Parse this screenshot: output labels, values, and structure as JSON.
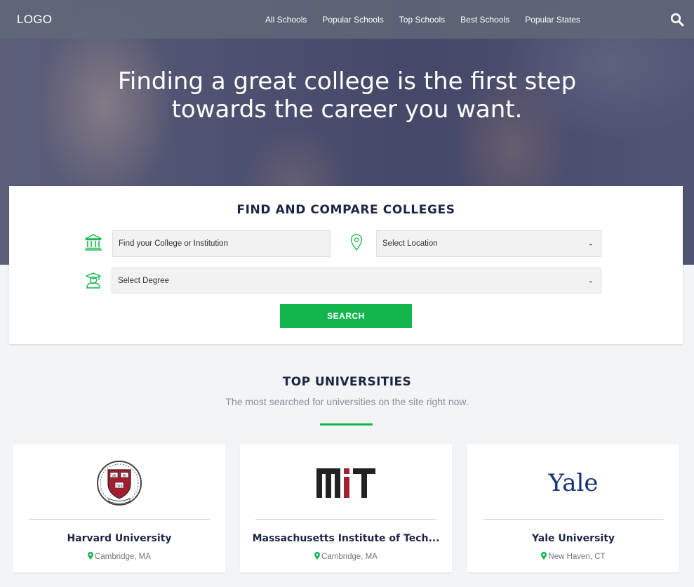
{
  "nav": {
    "logo": "LOGO",
    "items": [
      "All Schools",
      "Popular Schools",
      "Top Schools",
      "Best Schools",
      "Popular States"
    ]
  },
  "hero": {
    "line1": "Finding a great college is the first step",
    "line2": "towards the career you want."
  },
  "search": {
    "title": "FIND AND COMPARE COLLEGES",
    "college_placeholder": "Find your College or Institution",
    "location_value": "Select Location",
    "degree_value": "Select Degree",
    "button": "SEARCH"
  },
  "top": {
    "title": "TOP UNIVERSITIES",
    "subtitle": "The most searched for universities on the site right now.",
    "universities": [
      {
        "name": "Harvard University",
        "location": "Cambridge, MA"
      },
      {
        "name": "Massachusetts Institute of Tech...",
        "location": "Cambridge, MA"
      },
      {
        "name": "Yale University",
        "location": "New Haven, CT",
        "logo_text": "Yale"
      }
    ]
  },
  "colors": {
    "accent": "#12b54b",
    "heading": "#1d2545"
  }
}
